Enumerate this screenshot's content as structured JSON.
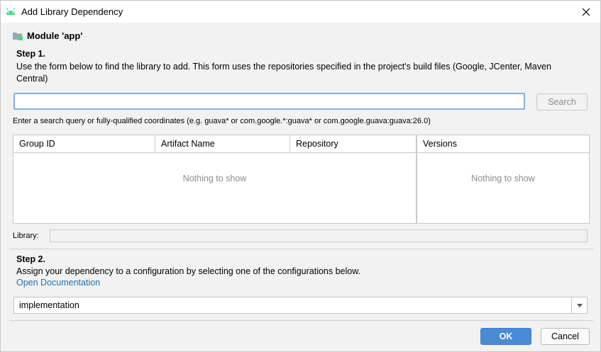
{
  "window": {
    "title": "Add Library Dependency",
    "app_icon": "android-icon",
    "close_icon": "close-icon"
  },
  "module": {
    "icon": "module-folder-icon",
    "label": "Module 'app'"
  },
  "step1": {
    "title": "Step 1.",
    "description": "Use the form below to find the library to add. This form uses the repositories specified in the project's build files (Google, JCenter, Maven Central)",
    "search_value": "",
    "search_button": "Search",
    "hint": "Enter a search query or fully-qualified coordinates (e.g. guava* or com.google.*:guava* or com.google.guava:guava:26.0)"
  },
  "results_table": {
    "columns": [
      "Group ID",
      "Artifact Name",
      "Repository"
    ],
    "empty_text": "Nothing to show"
  },
  "versions_table": {
    "columns": [
      "Versions"
    ],
    "empty_text": "Nothing to show"
  },
  "library": {
    "label": "Library:",
    "value": ""
  },
  "step2": {
    "title": "Step 2.",
    "description": "Assign your dependency to a configuration by selecting one of the configurations below.",
    "link": "Open Documentation",
    "configuration": "implementation"
  },
  "buttons": {
    "ok": "OK",
    "cancel": "Cancel"
  },
  "colors": {
    "android_green": "#3ddc84",
    "primary_button": "#4a8bd6",
    "link": "#2470b3",
    "focus_border": "#87afda"
  }
}
